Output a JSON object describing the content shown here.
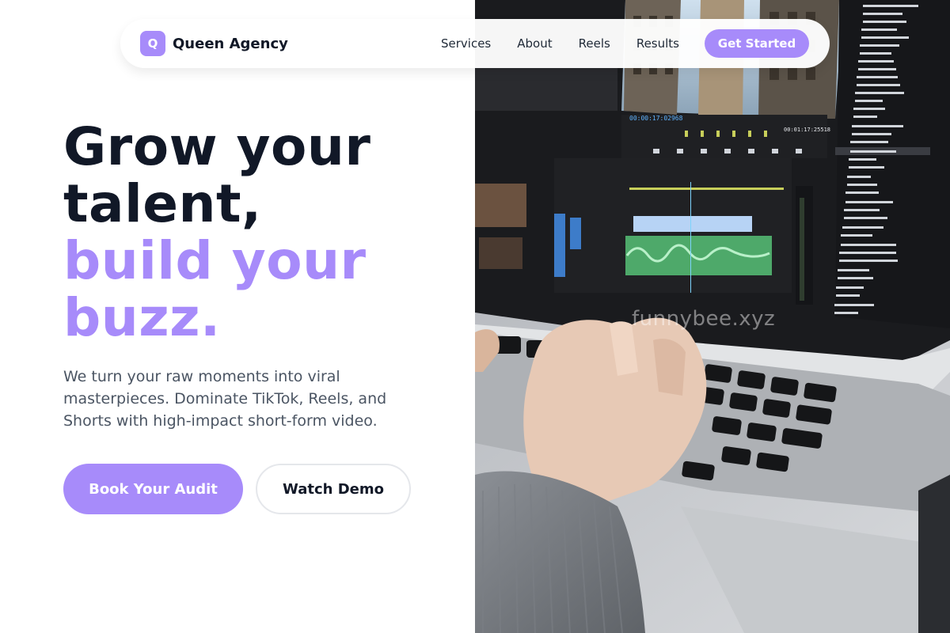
{
  "nav": {
    "logo_letter": "Q",
    "brand": "Queen Agency",
    "links": [
      "Services",
      "About",
      "Reels",
      "Results"
    ],
    "cta": "Get Started"
  },
  "hero": {
    "headline_lines": [
      "Grow your",
      "talent,",
      "build your",
      "buzz."
    ],
    "subtext": "We turn your raw moments into viral masterpieces. Dominate TikTok, Reels, and Shorts with high-impact short-form video.",
    "primary_button": "Book Your Audit",
    "secondary_button": "Watch Demo"
  },
  "photo": {
    "watermark": "funnybee.xyz",
    "timecode_main": "00:00:17:02968",
    "timecode_right": "00:01:17:25518"
  },
  "colors": {
    "accent": "#a78bfa",
    "text_dark": "#111827",
    "text_muted": "#4b5563"
  }
}
